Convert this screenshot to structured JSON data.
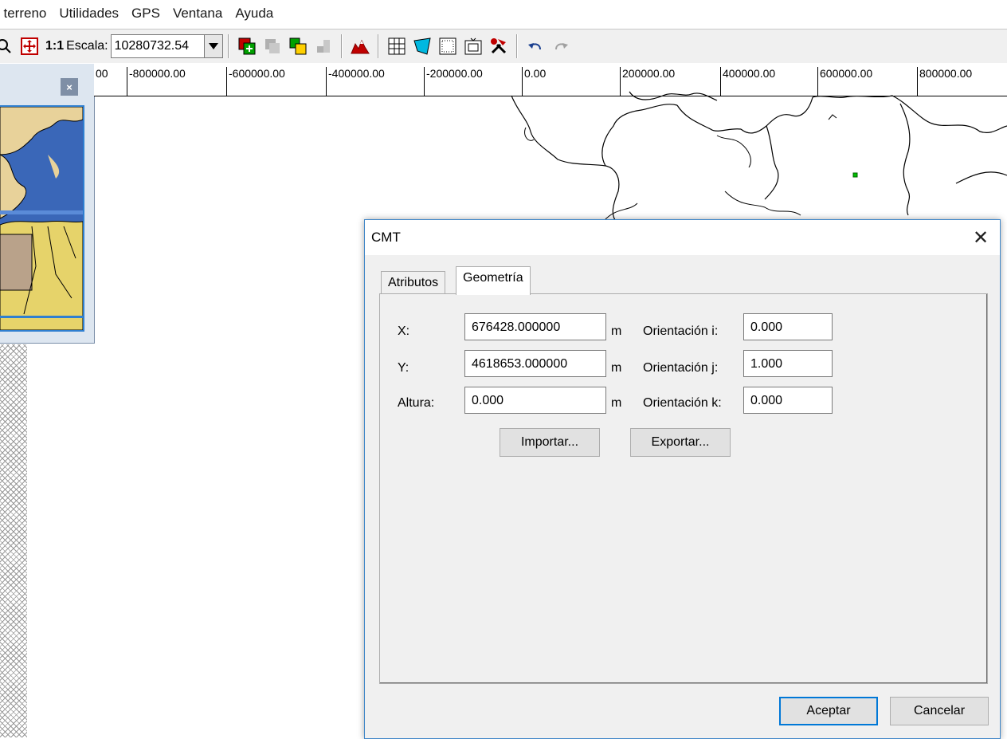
{
  "menu": [
    "l terreno",
    "Utilidades",
    "GPS",
    "Ventana",
    "Ayuda"
  ],
  "toolbar": {
    "scale_one_to_one": "1:1",
    "scale_label": "Escala:",
    "scale_value": "10280732.54"
  },
  "ruler": {
    "labels": [
      "00",
      "-800000.00",
      "-600000.00",
      "-400000.00",
      "-200000.00",
      "0.00",
      "200000.00",
      "400000.00",
      "600000.00",
      "800000.00"
    ]
  },
  "left_panel": {
    "close_label": "×"
  },
  "dialog": {
    "title": "CMT",
    "close_label": "✕",
    "tabs": [
      {
        "label": "Atributos"
      },
      {
        "label": "Geometría"
      }
    ],
    "active_tab": "Geometría",
    "fields": {
      "x_label": "X:",
      "x_value": "676428.000000",
      "y_label": "Y:",
      "y_value": "4618653.000000",
      "alt_label": "Altura:",
      "alt_value": "0.000",
      "unit": "m",
      "oi_label": "Orientación i:",
      "oi_value": "0.000",
      "oj_label": "Orientación j:",
      "oj_value": "1.000",
      "ok_label": "Orientación k:",
      "ok_value": "0.000"
    },
    "import_label": "Importar...",
    "export_label": "Exportar...",
    "accept_label": "Aceptar",
    "cancel_label": "Cancelar"
  },
  "colors": {
    "window_bg": "#f0f0f0",
    "dialog_border": "#3f86c8",
    "accent": "#0078d7",
    "map_point": "#00c000"
  }
}
